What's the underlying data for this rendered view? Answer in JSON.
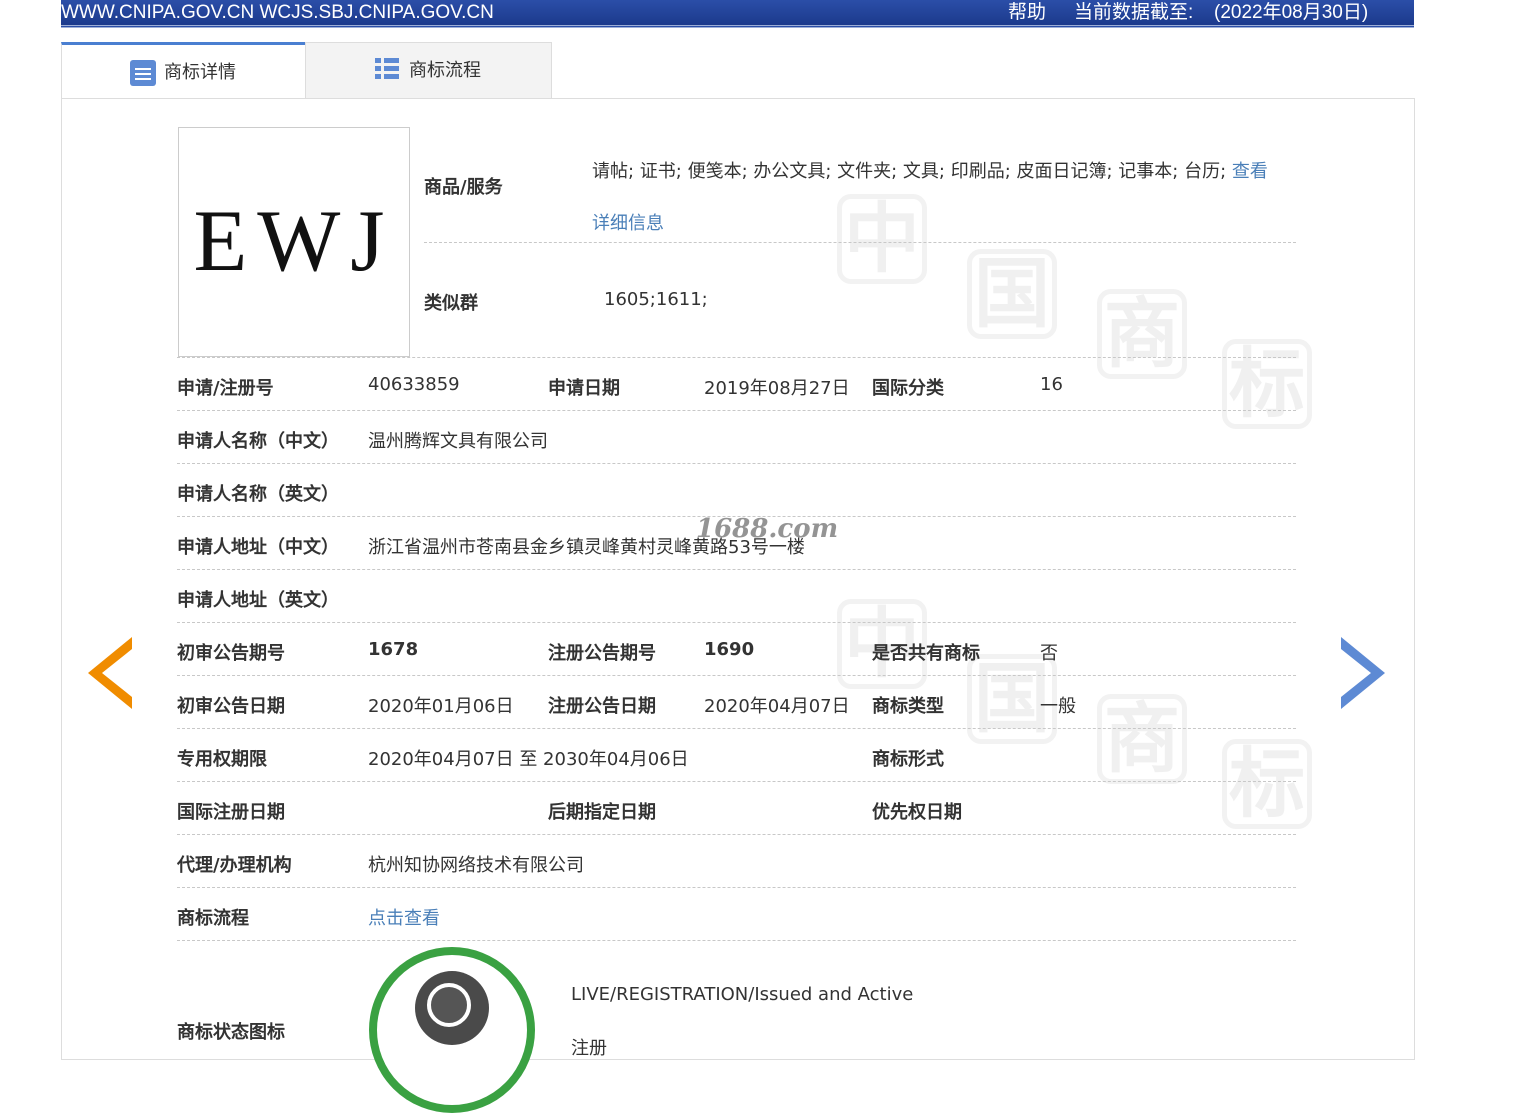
{
  "topbar": {
    "site": "WWW.CNIPA.GOV.CN WCJS.SBJ.CNIPA.GOV.CN",
    "help": "帮助",
    "cutoff_label": "当前数据截至:",
    "cutoff_date": "(2022年08月30日)"
  },
  "tabs": {
    "detail": "商标详情",
    "flow": "商标流程"
  },
  "mark": {
    "text": "EWJ"
  },
  "goods": {
    "label": "商品/服务",
    "value": "请帖; 证书; 便笺本; 办公文具; 文件夹; 文具; 印刷品; 皮面日记簿; 记事本; 台历;",
    "link_part1": "查看",
    "link_part2": "详细信息"
  },
  "similar": {
    "label": "类似群",
    "value": "1605;1611;"
  },
  "rows": {
    "reg_no_label": "申请/注册号",
    "reg_no": "40633859",
    "app_date_label": "申请日期",
    "app_date": "2019年08月27日",
    "intl_class_label": "国际分类",
    "intl_class": "16",
    "name_cn_label": "申请人名称（中文）",
    "name_cn": "温州腾辉文具有限公司",
    "name_en_label": "申请人名称（英文）",
    "name_en": "",
    "addr_cn_label": "申请人地址（中文）",
    "addr_cn": "浙江省温州市苍南县金乡镇灵峰黄村灵峰黄路53号一楼",
    "addr_en_label": "申请人地址（英文）",
    "addr_en": "",
    "prelim_no_label": "初审公告期号",
    "prelim_no": "1678",
    "reg_pub_no_label": "注册公告期号",
    "reg_pub_no": "1690",
    "shared_label": "是否共有商标",
    "shared": "否",
    "prelim_date_label": "初审公告日期",
    "prelim_date": "2020年01月06日",
    "reg_pub_date_label": "注册公告日期",
    "reg_pub_date": "2020年04月07日",
    "type_label": "商标类型",
    "type": "一般",
    "term_label": "专用权期限",
    "term": "2020年04月07日 至 2030年04月06日",
    "form_label": "商标形式",
    "form": "",
    "intl_reg_label": "国际注册日期",
    "intl_reg": "",
    "later_label": "后期指定日期",
    "later": "",
    "priority_label": "优先权日期",
    "priority": "",
    "agent_label": "代理/办理机构",
    "agent": "杭州知协网络技术有限公司",
    "flow_label": "商标流程",
    "flow_link": "点击查看",
    "status_label": "商标状态图标",
    "status_en": "LIVE/REGISTRATION/Issued and Active",
    "status_cn": "注册"
  },
  "watermark": {
    "stamp": "1688.com",
    "chars": [
      "中",
      "国",
      "商",
      "标"
    ]
  },
  "colors": {
    "accent": "#1c3a8c",
    "link": "#4a7fb8",
    "prev_arrow": "#f08c00",
    "next_arrow": "#5d8ad4",
    "status_green": "#3aa142"
  }
}
